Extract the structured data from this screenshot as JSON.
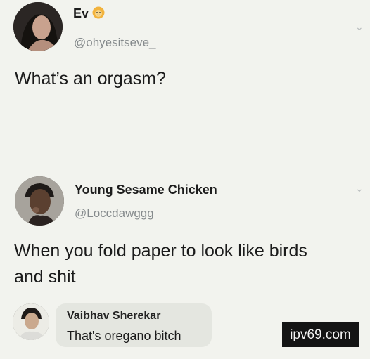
{
  "tweet1": {
    "name": "Ev",
    "badge_icon": "lion-emoji-icon",
    "handle": "@ohyesitseve_",
    "text": "What’s an orgasm?"
  },
  "tweet2": {
    "name": "Young Sesame Chicken",
    "handle": "@Loccdawggg",
    "text_line1": "When you fold paper to look like birds",
    "text_line2": "and shit"
  },
  "reply": {
    "name": "Vaibhav Sherekar",
    "text": "That's oregano bitch"
  },
  "watermark": "ipv69.com"
}
